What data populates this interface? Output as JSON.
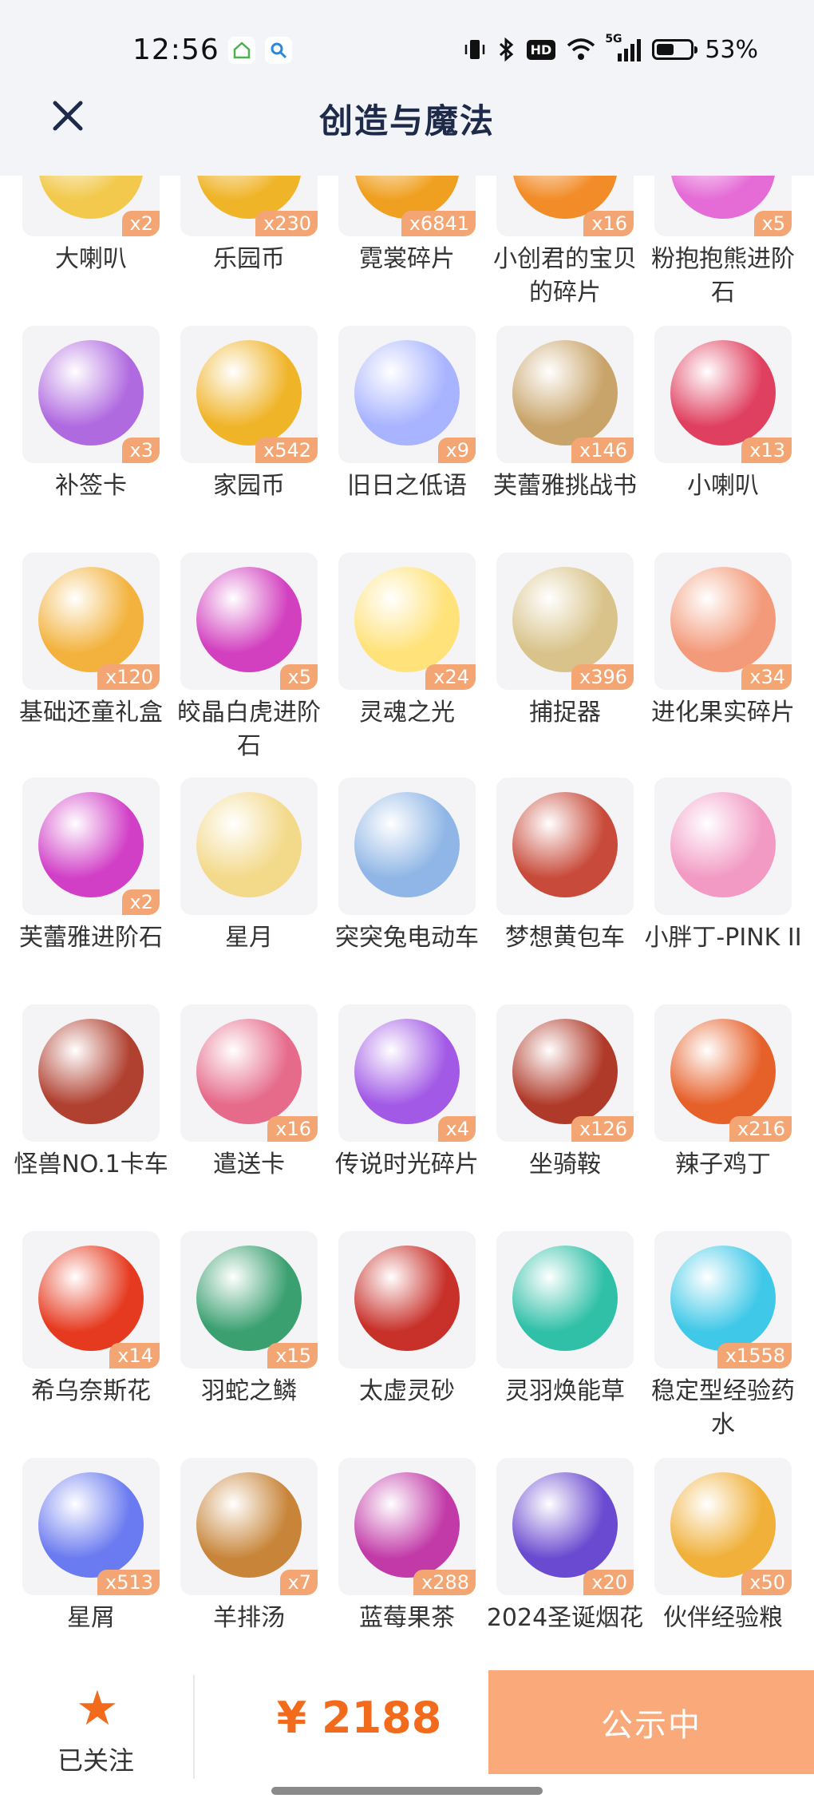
{
  "status_bar": {
    "time": "12:56",
    "hd": "HD",
    "net": "5G",
    "battery": "53%",
    "battery_fraction": 0.53
  },
  "header": {
    "close_icon": "close-icon",
    "title": "创造与魔法"
  },
  "items": [
    {
      "name": "大喇叭",
      "count": "x2",
      "color": "#f2c94c"
    },
    {
      "name": "乐园币",
      "count": "x230",
      "color": "#f0b429"
    },
    {
      "name": "霓裳碎片",
      "count": "x6841",
      "color": "#f0a020"
    },
    {
      "name": "小创君的宝贝的碎片",
      "count": "x16",
      "color": "#f28c28"
    },
    {
      "name": "粉抱抱熊进阶石",
      "count": "x5",
      "color": "#e56bd6"
    },
    {
      "name": "补签卡",
      "count": "x3",
      "color": "#b06ae0"
    },
    {
      "name": "家园币",
      "count": "x542",
      "color": "#f0b429"
    },
    {
      "name": "旧日之低语",
      "count": "x9",
      "color": "#a8b4ff"
    },
    {
      "name": "芙蕾雅挑战书",
      "count": "x146",
      "color": "#c9a46a"
    },
    {
      "name": "小喇叭",
      "count": "x13",
      "color": "#e04060"
    },
    {
      "name": "基础还童礼盒",
      "count": "x120",
      "color": "#f3b23d"
    },
    {
      "name": "皎晶白虎进阶石",
      "count": "x5",
      "color": "#d23fbf"
    },
    {
      "name": "灵魂之光",
      "count": "x24",
      "color": "#ffe27a"
    },
    {
      "name": "捕捉器",
      "count": "x396",
      "color": "#d9c38a"
    },
    {
      "name": "进化果实碎片",
      "count": "x34",
      "color": "#f39a7a"
    },
    {
      "name": "芙蕾雅进阶石",
      "count": "x2",
      "color": "#d13fc7"
    },
    {
      "name": "星月",
      "count": "",
      "color": "#f3d98a"
    },
    {
      "name": "突突兔电动车",
      "count": "",
      "color": "#8fb6e6"
    },
    {
      "name": "梦想黄包车",
      "count": "",
      "color": "#c84a3a"
    },
    {
      "name": "小胖丁-PINK II",
      "count": "",
      "color": "#f29ac4"
    },
    {
      "name": "怪兽NO.1卡车",
      "count": "",
      "color": "#b04030"
    },
    {
      "name": "遣送卡",
      "count": "x16",
      "color": "#e66a8a"
    },
    {
      "name": "传说时光碎片",
      "count": "x4",
      "color": "#a25ae6"
    },
    {
      "name": "坐骑鞍",
      "count": "x126",
      "color": "#b03a2a"
    },
    {
      "name": "辣子鸡丁",
      "count": "x216",
      "color": "#e6602a"
    },
    {
      "name": "希乌奈斯花",
      "count": "x14",
      "color": "#e63a20"
    },
    {
      "name": "羽蛇之鳞",
      "count": "x15",
      "color": "#3aa070"
    },
    {
      "name": "太虚灵砂",
      "count": "",
      "color": "#c8302a"
    },
    {
      "name": "灵羽焕能草",
      "count": "",
      "color": "#30c0a8"
    },
    {
      "name": "稳定型经验药水",
      "count": "x1558",
      "color": "#40c8e8"
    },
    {
      "name": "星屑",
      "count": "x513",
      "color": "#6a7af0"
    },
    {
      "name": "羊排汤",
      "count": "x7",
      "color": "#c8853a"
    },
    {
      "name": "蓝莓果茶",
      "count": "x288",
      "color": "#c23aa8"
    },
    {
      "name": "2024圣诞烟花",
      "count": "x20",
      "color": "#6a4ad0"
    },
    {
      "name": "伙伴经验粮",
      "count": "x50",
      "color": "#f0b03a"
    }
  ],
  "bottom_bar": {
    "follow_label": "已关注",
    "star_icon": "star-icon",
    "price": "¥ 2188",
    "cta_label": "公示中"
  },
  "colors": {
    "accent": "#f26a1b",
    "cta_bg": "#f9a97a",
    "badge_bg": "#f3a673",
    "header_bg": "#f2f4f8",
    "title": "#1e2a4a"
  }
}
